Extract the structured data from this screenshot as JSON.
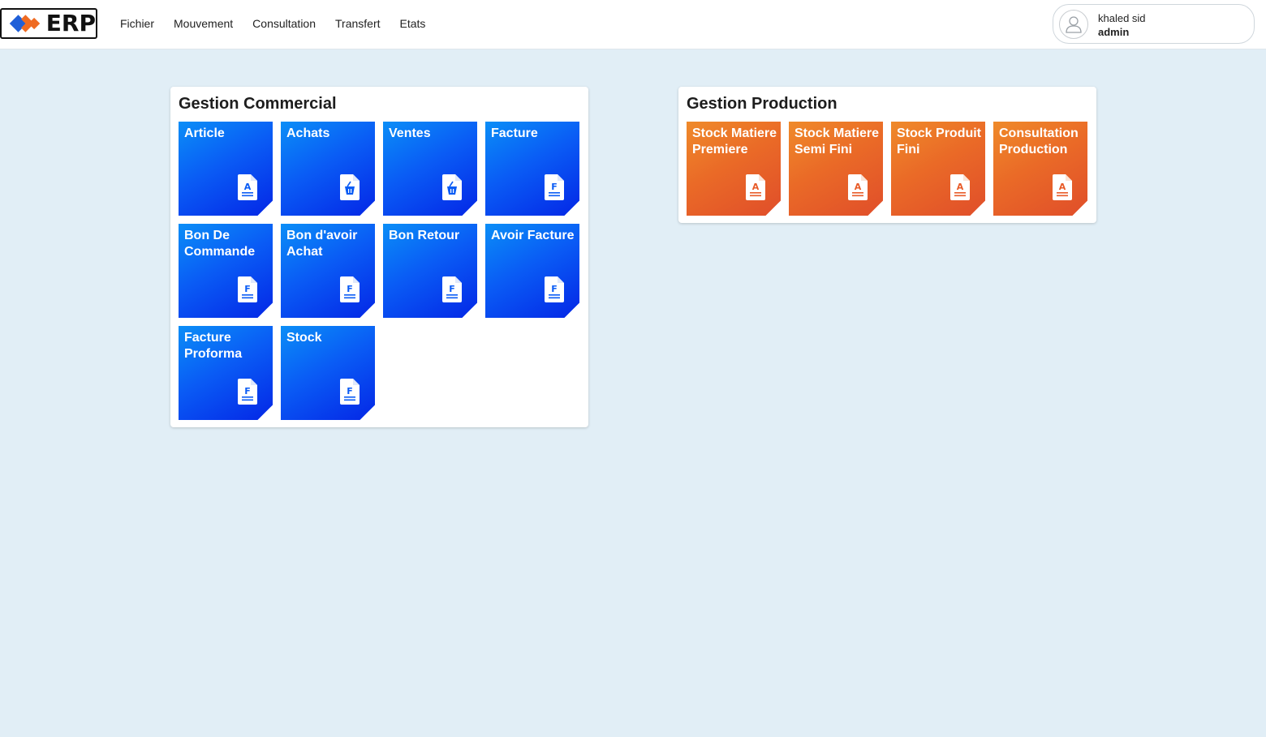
{
  "header": {
    "logo_text": "ERP",
    "menu": [
      "Fichier",
      "Mouvement",
      "Consultation",
      "Transfert",
      "Etats"
    ],
    "user": {
      "name": "khaled sid",
      "role": "admin"
    }
  },
  "commercial": {
    "title": "Gestion Commercial",
    "tiles": [
      {
        "label": "Article",
        "icon": "document-a-icon"
      },
      {
        "label": "Achats",
        "icon": "document-basket-icon"
      },
      {
        "label": "Ventes",
        "icon": "document-basket-icon"
      },
      {
        "label": "Facture",
        "icon": "document-f-icon"
      },
      {
        "label": "Bon De Commande",
        "icon": "document-f-icon"
      },
      {
        "label": "Bon d'avoir Achat",
        "icon": "document-f-icon"
      },
      {
        "label": "Bon Retour",
        "icon": "document-f-icon"
      },
      {
        "label": "Avoir Facture",
        "icon": "document-f-icon"
      },
      {
        "label": "Facture Proforma",
        "icon": "document-f-icon"
      },
      {
        "label": "Stock",
        "icon": "document-f-icon"
      }
    ]
  },
  "production": {
    "title": "Gestion Production",
    "tiles": [
      {
        "label": "Stock Matiere Premiere",
        "icon": "document-a-icon"
      },
      {
        "label": "Stock Matiere Semi Fini",
        "icon": "document-a-icon"
      },
      {
        "label": "Stock Produit Fini",
        "icon": "document-a-icon"
      },
      {
        "label": "Consultation Production",
        "icon": "document-a-icon"
      }
    ]
  },
  "colors": {
    "background": "#e1eef6",
    "commercial_tile": "#0a5cf5",
    "production_tile": "#ea6a27"
  }
}
